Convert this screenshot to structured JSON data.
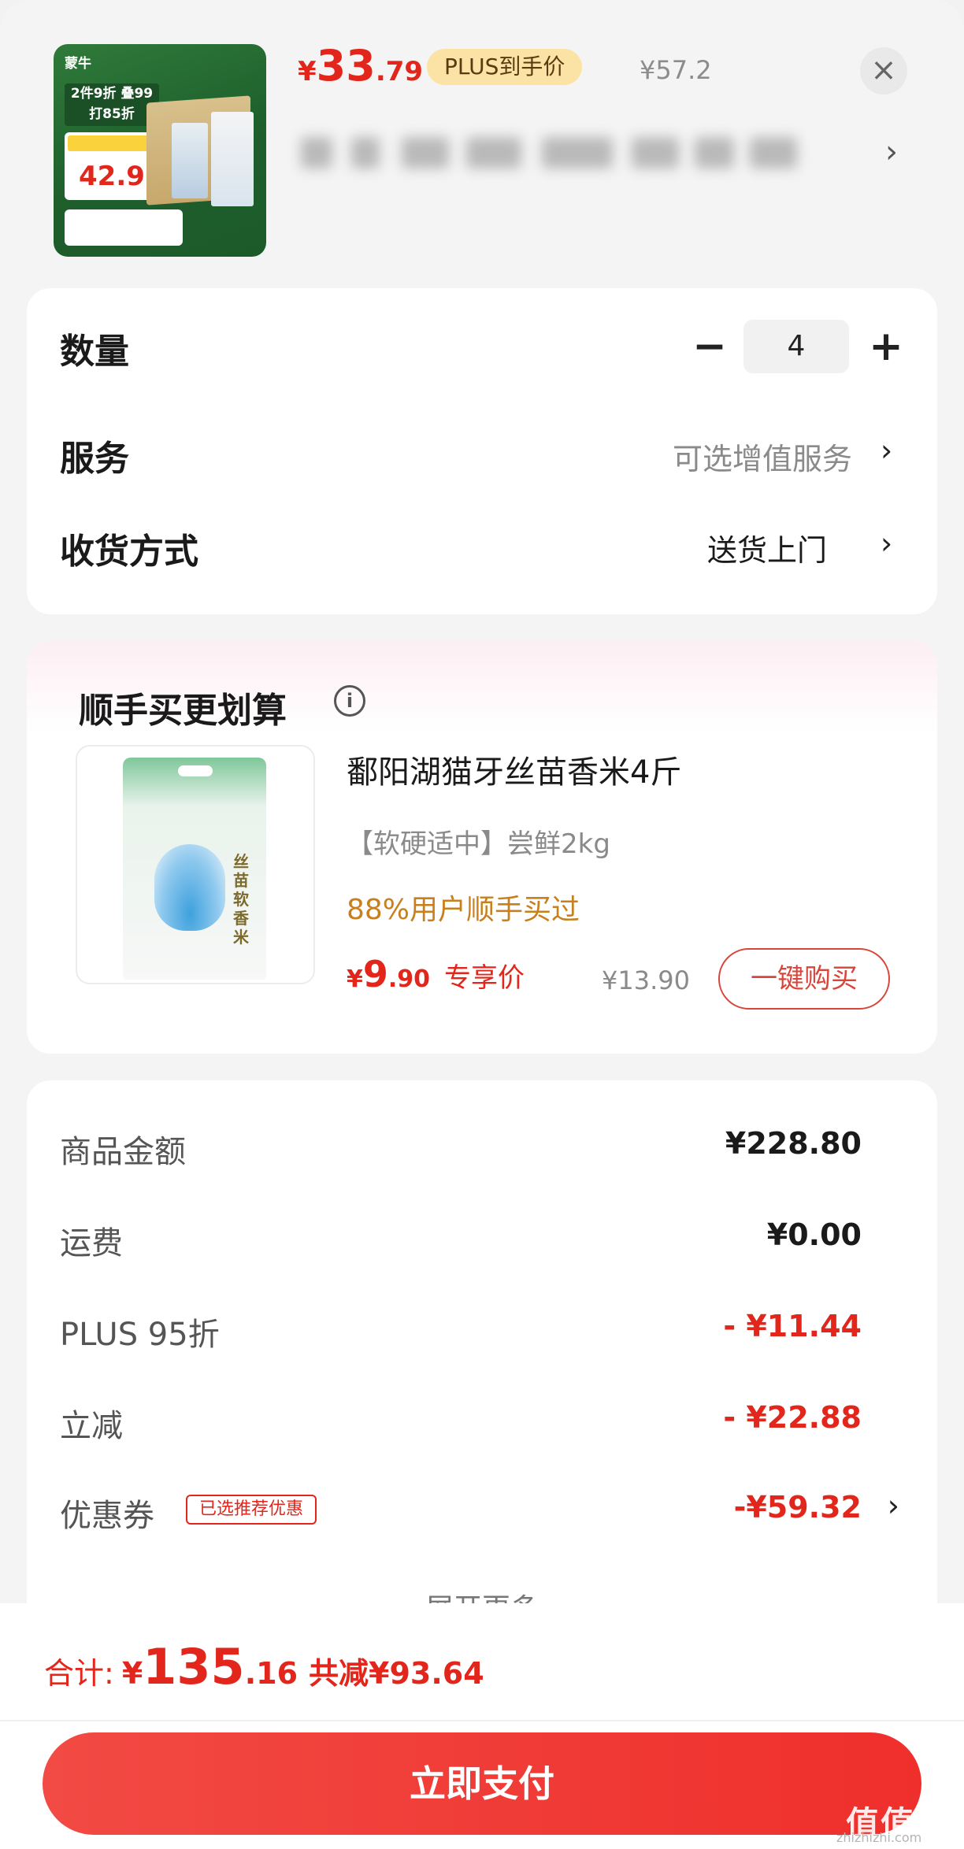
{
  "product": {
    "price_currency": "¥",
    "price_int": "33",
    "price_dec": ".79",
    "plus_label": "PLUS到手价",
    "original_price": "¥57.2",
    "close_icon": "close-icon",
    "chevron": "›",
    "thumbnail": {
      "brand": "蒙牛",
      "promo": "2件9折 叠99打85折",
      "price": "42.9"
    }
  },
  "options": {
    "quantity_label": "数量",
    "quantity_value": "4",
    "minus": "−",
    "plus": "+",
    "service_label": "服务",
    "service_value": "可选增值服务",
    "delivery_label": "收货方式",
    "delivery_value": "送货上门",
    "chevron": "›"
  },
  "recommend": {
    "title": "顺手买更划算",
    "info_icon": "i",
    "item_name": "鄱阳湖猫牙丝苗香米4斤",
    "item_spec": "【软硬适中】尝鲜2kg",
    "social_proof": "88%用户顺手买过",
    "price_currency": "¥",
    "price_int": "9",
    "price_dec": ".90",
    "price_tag": "专享价",
    "original_price": "¥13.90",
    "buy_button": "一键购买",
    "bag_label": "丝苗软香米"
  },
  "summary": {
    "rows": [
      {
        "label": "商品金额",
        "value": "¥228.80"
      },
      {
        "label": "运费",
        "value": "¥0.00"
      },
      {
        "label": "PLUS 95折",
        "value": "- ¥11.44"
      },
      {
        "label": "立减",
        "value": "- ¥22.88"
      },
      {
        "label": "优惠券",
        "value": "-¥59.32"
      }
    ],
    "coupon_tag": "已选推荐优惠",
    "expand": "展开更多",
    "chevron": "›"
  },
  "footer": {
    "total_label": "合计:",
    "total_currency": "¥",
    "total_int": "135",
    "total_dec": ".16",
    "saved": "共减¥93.64",
    "pay_button": "立即支付"
  },
  "watermark": {
    "text": "值值值",
    "sub": "zhizhizhi.com"
  },
  "colors": {
    "accent_red": "#e3261b",
    "plus_gold": "#fbe3a5",
    "social_orange": "#c8801e"
  }
}
